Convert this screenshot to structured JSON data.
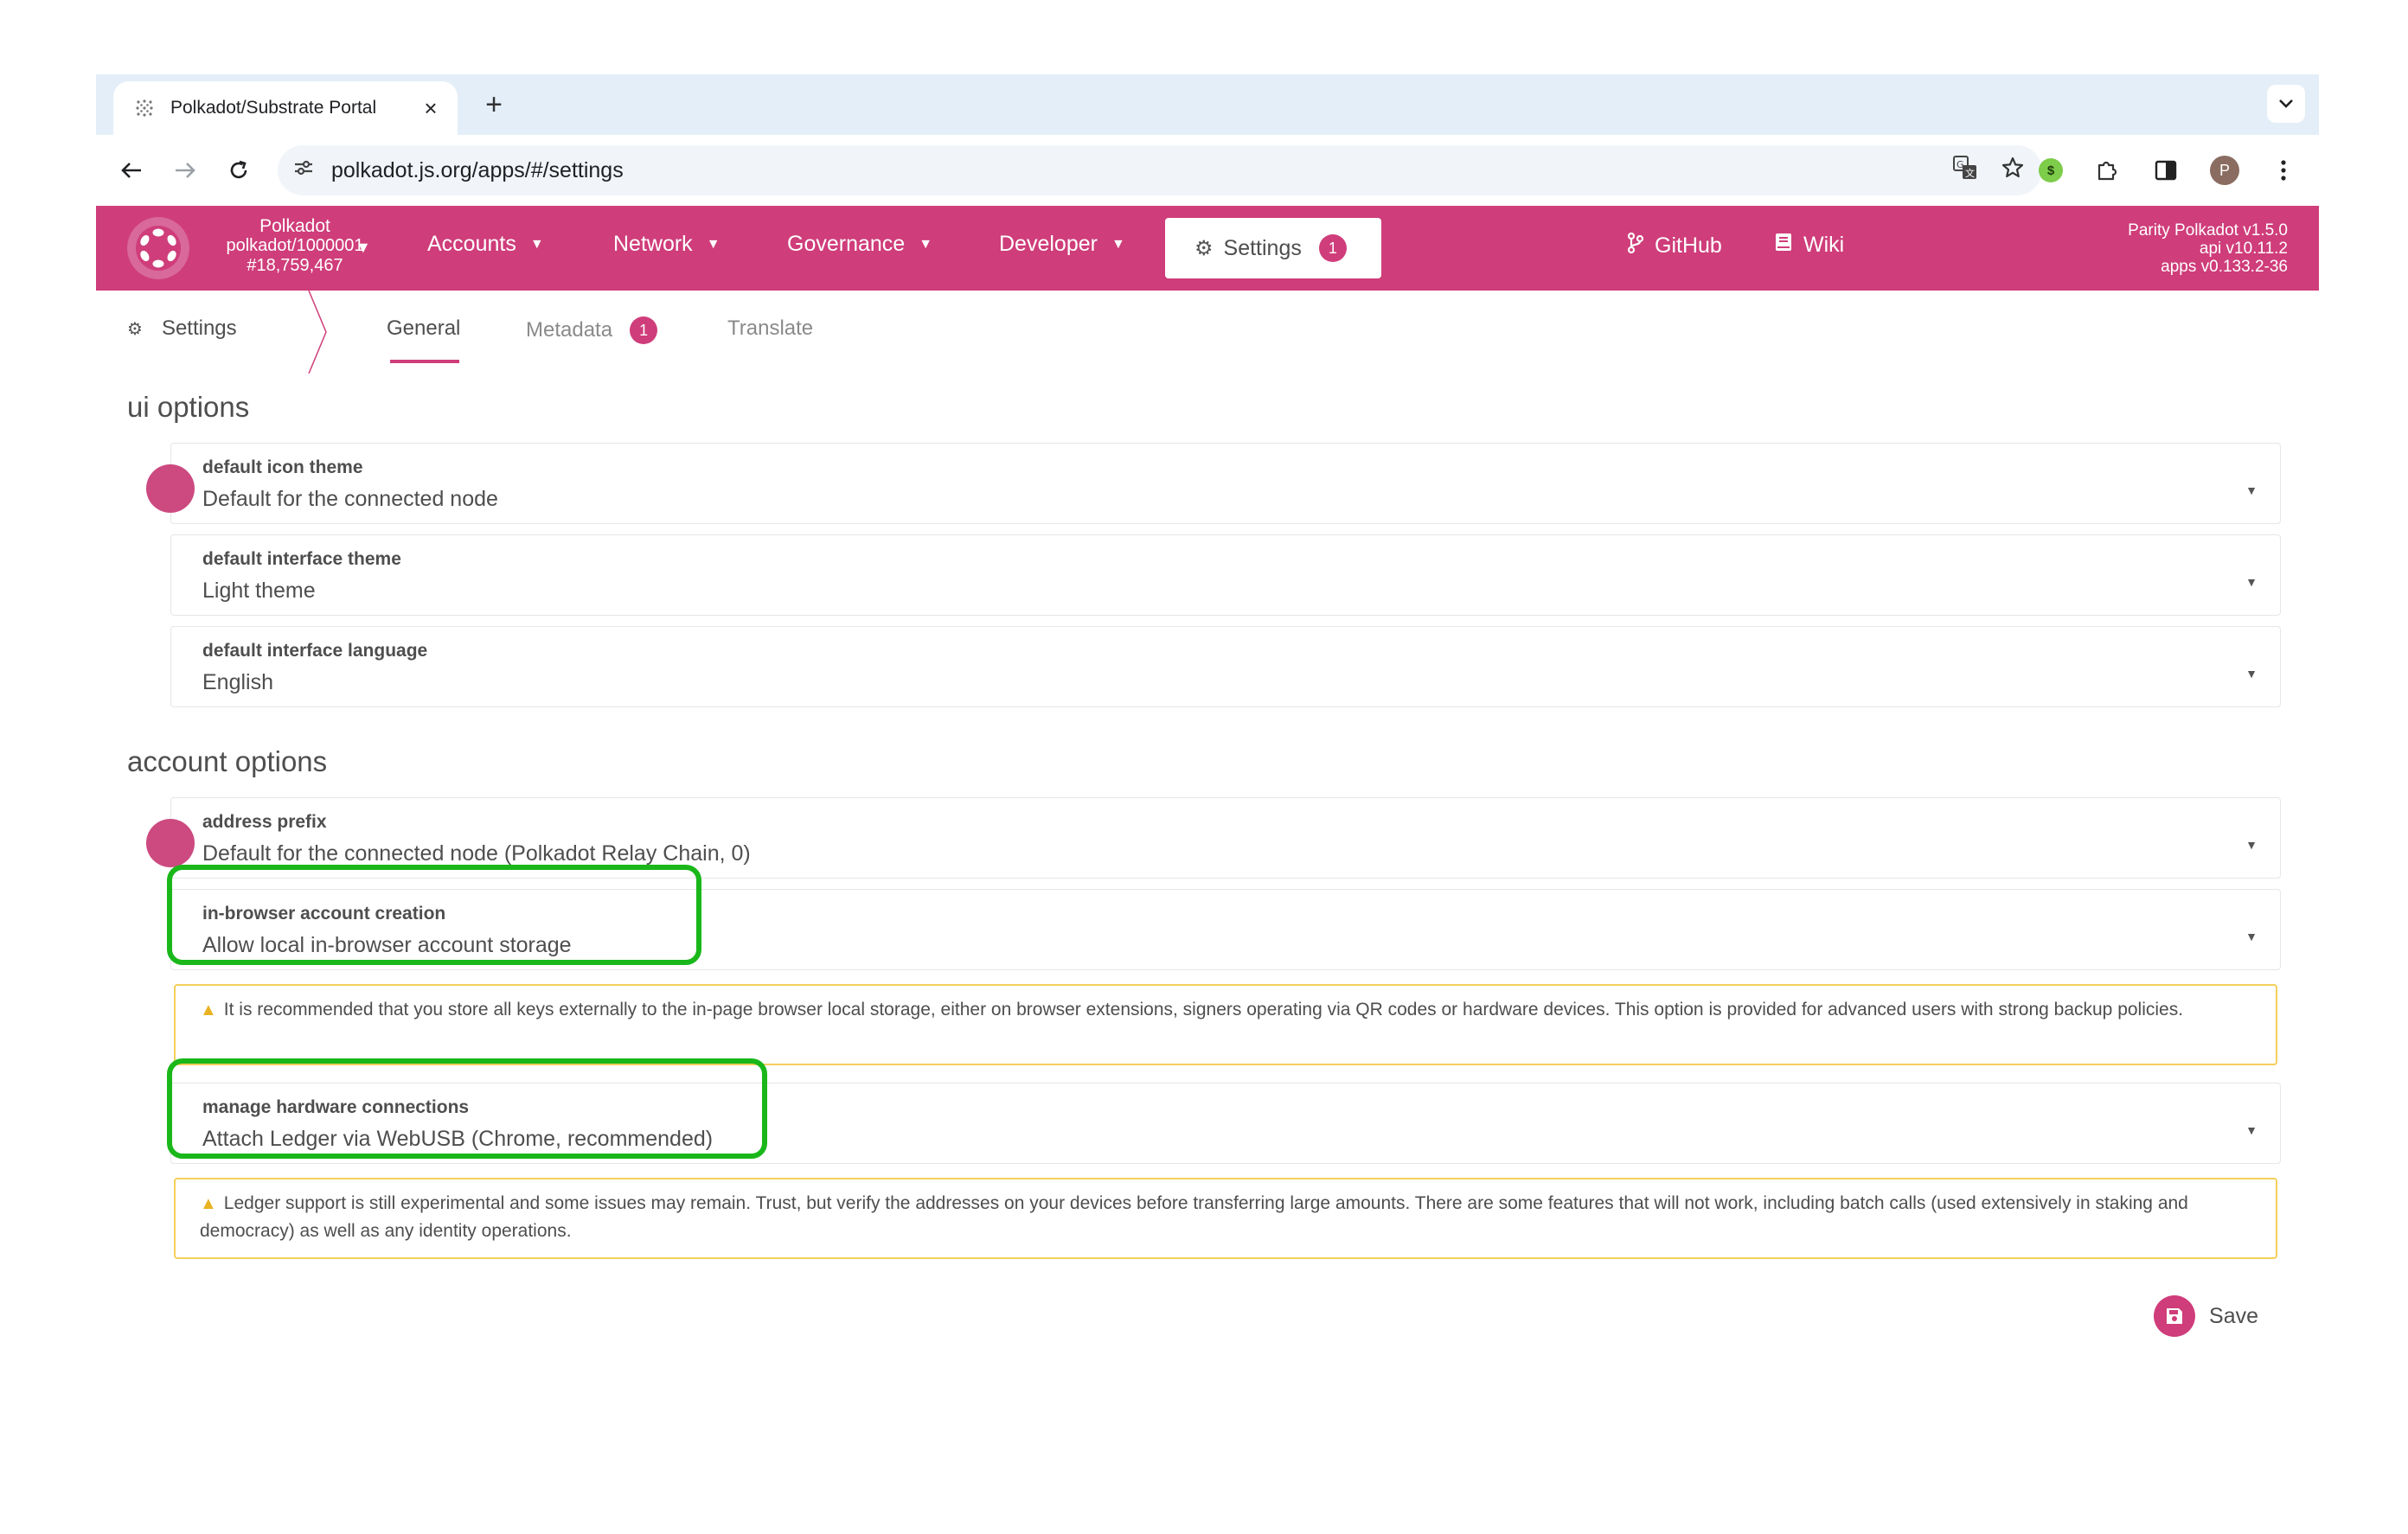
{
  "browser": {
    "tab_title": "Polkadot/Substrate Portal",
    "url": "polkadot.js.org/apps/#/settings",
    "profile_initial": "P"
  },
  "app": {
    "chain": {
      "name": "Polkadot",
      "node": "polkadot/1000001",
      "block": "#18,759,467"
    },
    "menu": [
      "Accounts",
      "Network",
      "Governance",
      "Developer"
    ],
    "settings_label": "Settings",
    "settings_badge": "1",
    "links": [
      "GitHub",
      "Wiki"
    ],
    "versions": [
      "Parity Polkadot v1.5.0",
      "api v10.11.2",
      "apps v0.133.2-36"
    ]
  },
  "subnav": {
    "crumb": "Settings",
    "tabs": [
      {
        "label": "General",
        "active": true
      },
      {
        "label": "Metadata",
        "badge": "1"
      },
      {
        "label": "Translate"
      }
    ]
  },
  "ui_options": {
    "title": "ui options",
    "fields": [
      {
        "label": "default icon theme",
        "value": "Default for the connected node"
      },
      {
        "label": "default interface theme",
        "value": "Light theme"
      },
      {
        "label": "default interface language",
        "value": "English"
      }
    ]
  },
  "account_options": {
    "title": "account options",
    "fields": [
      {
        "label": "address prefix",
        "value": "Default for the connected node (Polkadot Relay Chain, 0)"
      },
      {
        "label": "in-browser account creation",
        "value": "Allow local in-browser account storage"
      },
      {
        "label": "manage hardware connections",
        "value": "Attach Ledger via WebUSB (Chrome, recommended)"
      }
    ],
    "warnings": [
      "It is recommended that you store all keys externally to the in-page browser local storage, either on browser extensions, signers operating via QR codes or hardware devices. This option is provided for advanced users with strong backup policies.",
      "Ledger support is still experimental and some issues may remain. Trust, but verify the addresses on your devices before transferring large amounts. There are some features that will not work, including batch calls (used extensively in staking and democracy) as well as any identity operations."
    ]
  },
  "save_label": "Save",
  "colors": {
    "brand": "#cf3d7a",
    "highlight": "#1ab71a",
    "warning_border": "#f5cf5b"
  }
}
